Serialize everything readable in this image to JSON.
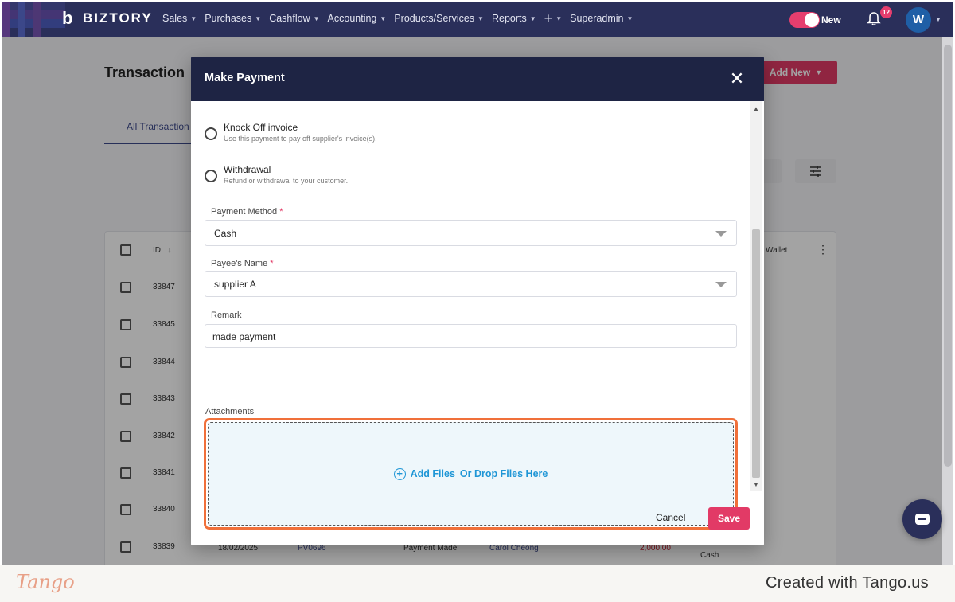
{
  "app": {
    "brand": "BIZTORY",
    "menu": [
      "Sales",
      "Purchases",
      "Cashflow",
      "Accounting",
      "Products/Services",
      "Reports",
      "+",
      "Superadmin"
    ],
    "toggle_label": "New",
    "notification_count": "12",
    "avatar_initial": "W"
  },
  "page": {
    "title": "Transaction",
    "add_new_label": "Add New",
    "tab_all": "All Transaction",
    "table": {
      "col_id": "ID",
      "col_wallet": "Wallet",
      "rows": [
        "33847",
        "33845",
        "33844",
        "33843",
        "33842",
        "33841",
        "33840",
        "33839"
      ],
      "last_row_partial": {
        "date": "18/02/2025",
        "ref": "PV0696",
        "type": "Payment Made",
        "contact": "Carol Cheong",
        "amount": "2,000.00",
        "wallet": "Cash"
      }
    }
  },
  "modal": {
    "title": "Make Payment",
    "options": [
      {
        "label": "Knock Off invoice",
        "desc": "Use this payment to pay off supplier's invoice(s)."
      },
      {
        "label": "Withdrawal",
        "desc": "Refund or withdrawal to your customer."
      }
    ],
    "payment_method": {
      "label": "Payment Method",
      "value": "Cash"
    },
    "payee_name": {
      "label": "Payee's Name",
      "value": "supplier A"
    },
    "remark": {
      "label": "Remark",
      "value": "made payment"
    },
    "attachments": {
      "label": "Attachments",
      "add_files": "Add Files",
      "drop_text": "Or Drop Files Here"
    },
    "cancel_label": "Cancel",
    "save_label": "Save"
  },
  "footer": {
    "tango_logo": "Tango",
    "created_with": "Created with Tango.us"
  },
  "colors": {
    "nav_bg": "#2a2f5a",
    "modal_header": "#1e2444",
    "accent": "#e23a66",
    "link_blue": "#1e96d6",
    "highlight_orange": "#f0703a"
  }
}
